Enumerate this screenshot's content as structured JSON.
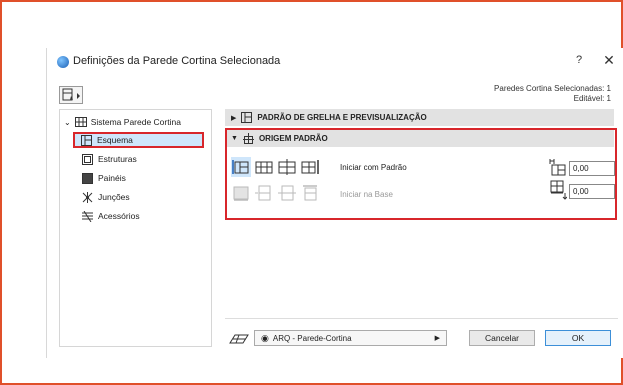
{
  "window": {
    "title": "Definições da Parede Cortina Selecionada",
    "help": "?",
    "close": "✕"
  },
  "selection": {
    "line1": "Paredes Cortina Selecionadas: 1",
    "line2": "Editável: 1"
  },
  "tree": {
    "root": "Sistema Parede Cortina",
    "items": [
      {
        "label": "Esquema",
        "icon": "schema-icon",
        "selected": true
      },
      {
        "label": "Estruturas",
        "icon": "frame-icon",
        "selected": false
      },
      {
        "label": "Painéis",
        "icon": "panel-icon",
        "selected": false
      },
      {
        "label": "Junções",
        "icon": "junction-icon",
        "selected": false
      },
      {
        "label": "Acessórios",
        "icon": "accessory-icon",
        "selected": false
      }
    ]
  },
  "sections": {
    "grid": "PADRÃO DE GRELHA E PREVISUALIZAÇÃO",
    "origin": "ORIGEM PADRÃO"
  },
  "origin": {
    "start_label": "Iniciar com Padrão",
    "base_label": "Iniciar na Base",
    "offset_x": "0,00",
    "offset_y": "0,00"
  },
  "footer": {
    "favorite": "ARQ - Parede-Cortina",
    "cancel": "Cancelar",
    "ok": "OK"
  },
  "colors": {
    "highlight": "#d8262b",
    "selection_bg": "#cfe6fb",
    "accent": "#3c8fd8"
  }
}
